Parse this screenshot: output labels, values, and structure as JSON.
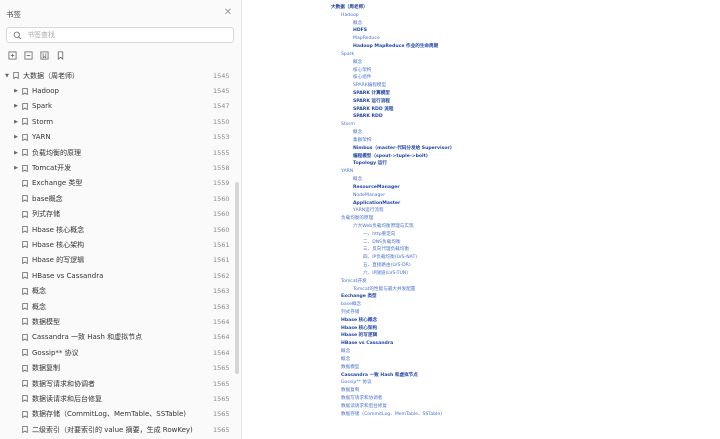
{
  "panel": {
    "title": "书签",
    "search_placeholder": "书签查找",
    "tree": [
      {
        "label": "大数据（周老师）",
        "page": "1545",
        "depth": 0,
        "arrow": "down"
      },
      {
        "label": "Hadoop",
        "page": "1545",
        "depth": 1,
        "arrow": "right"
      },
      {
        "label": "Spark",
        "page": "1547",
        "depth": 1,
        "arrow": "right"
      },
      {
        "label": "Storm",
        "page": "1550",
        "depth": 1,
        "arrow": "right"
      },
      {
        "label": "YARN",
        "page": "1553",
        "depth": 1,
        "arrow": "right"
      },
      {
        "label": "负载均衡的原理",
        "page": "1555",
        "depth": 1,
        "arrow": "right"
      },
      {
        "label": "Tomcat开发",
        "page": "1558",
        "depth": 1,
        "arrow": "right"
      },
      {
        "label": "Exchange 类型",
        "page": "1559",
        "depth": 1,
        "arrow": ""
      },
      {
        "label": "base概念",
        "page": "1560",
        "depth": 1,
        "arrow": ""
      },
      {
        "label": "列式存储",
        "page": "1560",
        "depth": 1,
        "arrow": ""
      },
      {
        "label": "Hbase 核心概念",
        "page": "1560",
        "depth": 1,
        "arrow": ""
      },
      {
        "label": "Hbase 核心架构",
        "page": "1561",
        "depth": 1,
        "arrow": ""
      },
      {
        "label": "Hbase 的写逻辑",
        "page": "1561",
        "depth": 1,
        "arrow": ""
      },
      {
        "label": "HBase vs Cassandra",
        "page": "1562",
        "depth": 1,
        "arrow": ""
      },
      {
        "label": "概念",
        "page": "1563",
        "depth": 1,
        "arrow": ""
      },
      {
        "label": "概念",
        "page": "1563",
        "depth": 1,
        "arrow": ""
      },
      {
        "label": "数据模型",
        "page": "1564",
        "depth": 1,
        "arrow": ""
      },
      {
        "label": "Cassandra 一致 Hash 和虚拟节点",
        "page": "1564",
        "depth": 1,
        "arrow": ""
      },
      {
        "label": "Gossip** 协议",
        "page": "1564",
        "depth": 1,
        "arrow": ""
      },
      {
        "label": "数据复制",
        "page": "1565",
        "depth": 1,
        "arrow": ""
      },
      {
        "label": "数据写请求和协调者",
        "page": "1565",
        "depth": 1,
        "arrow": ""
      },
      {
        "label": "数据读请求和后台修复",
        "page": "1565",
        "depth": 1,
        "arrow": ""
      },
      {
        "label": "数据存储（CommitLog、MemTable、SSTable)",
        "page": "1565",
        "depth": 1,
        "arrow": ""
      },
      {
        "label": "二级索引（对要索引的 value 摘要，生成 RowKey)",
        "page": "1565",
        "depth": 1,
        "arrow": ""
      }
    ]
  },
  "doc": {
    "lines": [
      {
        "text": "大数据（周老师）",
        "cls": "lvl0"
      },
      {
        "text": "Hadoop",
        "cls": "lvl1"
      },
      {
        "text": "概念",
        "cls": "lvl2"
      },
      {
        "text": "HDFS",
        "cls": "lvl2b"
      },
      {
        "text": "MapReduce",
        "cls": "lvl2"
      },
      {
        "text": "Hadoop MapReduce 作业的生命周期",
        "cls": "lvl2b"
      },
      {
        "text": "Spark",
        "cls": "lvl1"
      },
      {
        "text": "概念",
        "cls": "lvl2"
      },
      {
        "text": "核心架构",
        "cls": "lvl2"
      },
      {
        "text": "核心组件",
        "cls": "lvl2"
      },
      {
        "text": "SPARK编程模型",
        "cls": "lvl2"
      },
      {
        "text": "SPARK 计算模型",
        "cls": "lvl2b"
      },
      {
        "text": "SPARK 运行流程",
        "cls": "lvl2b"
      },
      {
        "text": "SPARK RDD 流程",
        "cls": "lvl2b"
      },
      {
        "text": "SPARK RDD",
        "cls": "lvl2b"
      },
      {
        "text": "Storm",
        "cls": "lvl1"
      },
      {
        "text": "概念",
        "cls": "lvl2"
      },
      {
        "text": "集群架构",
        "cls": "lvl2"
      },
      {
        "text": "Nimbus（master-代码分发给 Supervisor)",
        "cls": "lvl2b"
      },
      {
        "text": "编程模型（spout->tuple->bolt)",
        "cls": "lvl2b"
      },
      {
        "text": "Topology 运行",
        "cls": "lvl2b"
      },
      {
        "text": "YARN",
        "cls": "lvl1"
      },
      {
        "text": "概念",
        "cls": "lvl2"
      },
      {
        "text": "ResourceManager",
        "cls": "lvl2b"
      },
      {
        "text": "NodeManager",
        "cls": "lvl2"
      },
      {
        "text": "ApplicationMaster",
        "cls": "lvl2b"
      },
      {
        "text": "YARN运行流程",
        "cls": "lvl2"
      },
      {
        "text": "负载均衡的原理",
        "cls": "lvl1"
      },
      {
        "text": "六大Web负载均衡原理与实现",
        "cls": "lvl2"
      },
      {
        "text": "一、http重定向",
        "cls": "lvl4"
      },
      {
        "text": "二、DNS负载均衡",
        "cls": "lvl4"
      },
      {
        "text": "三、反向代理负载均衡",
        "cls": "lvl4"
      },
      {
        "text": "四、IP负载均衡(LVS-NAT)",
        "cls": "lvl4"
      },
      {
        "text": "五、直接路由(LVS-DR)",
        "cls": "lvl4"
      },
      {
        "text": "六、IP隧道(LVS-TUN)",
        "cls": "lvl4"
      },
      {
        "text": "Tomcat开发",
        "cls": "lvl1"
      },
      {
        "text": "Tomcat的性能与最大并发配置",
        "cls": "lvl2"
      },
      {
        "text": "Exchange 类型",
        "cls": "flatb"
      },
      {
        "text": "base概念",
        "cls": "flat"
      },
      {
        "text": "列式存储",
        "cls": "flat"
      },
      {
        "text": "Hbase 核心概念",
        "cls": "flatb"
      },
      {
        "text": "Hbase 核心架构",
        "cls": "flatb"
      },
      {
        "text": "Hbase 的写逻辑",
        "cls": "flatb"
      },
      {
        "text": "HBase vs Cassandra",
        "cls": "flatb"
      },
      {
        "text": "概念",
        "cls": "flat"
      },
      {
        "text": "概念",
        "cls": "flat"
      },
      {
        "text": "数据模型",
        "cls": "flat"
      },
      {
        "text": "Cassandra 一致 Hash 和虚拟节点",
        "cls": "flatb"
      },
      {
        "text": "Gossip** 协议",
        "cls": "flat"
      },
      {
        "text": "数据复制",
        "cls": "flat"
      },
      {
        "text": "数据写请求和协调者",
        "cls": "flat"
      },
      {
        "text": "数据读请求和后台修复",
        "cls": "flat"
      },
      {
        "text": "数据存储（CommitLog、MemTable、SSTable)",
        "cls": "flat"
      }
    ]
  },
  "colors": {
    "link_blue": "#4a72c9",
    "heading_blue": "#1b3f99",
    "panel_bg": "#fafafa"
  },
  "icons": {
    "search": "search-icon",
    "close": "close-icon",
    "bookmark": "bookmark-icon"
  }
}
